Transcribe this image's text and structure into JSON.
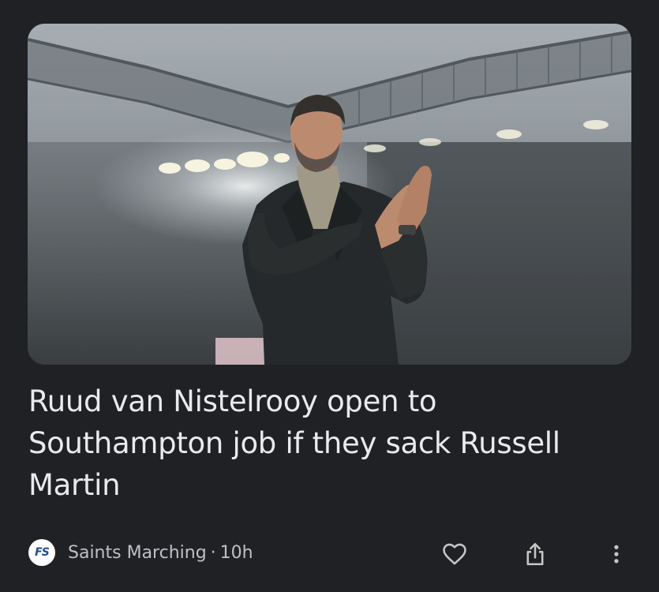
{
  "article": {
    "headline": "Ruud van Nistelrooy open to Southampton job if they sack Russell Martin",
    "image_icon": "stadium-photo",
    "source": {
      "logo_text": "FS",
      "name": "Saints Marching",
      "separator": "·",
      "age": "10h"
    }
  },
  "actions": {
    "like_icon": "heart-outline-icon",
    "share_icon": "share-icon",
    "more_icon": "more-vertical-icon"
  },
  "colors": {
    "background": "#202124",
    "headline": "#e8eaed",
    "meta": "#bdc1c6",
    "icon": "#c4c7c5"
  }
}
